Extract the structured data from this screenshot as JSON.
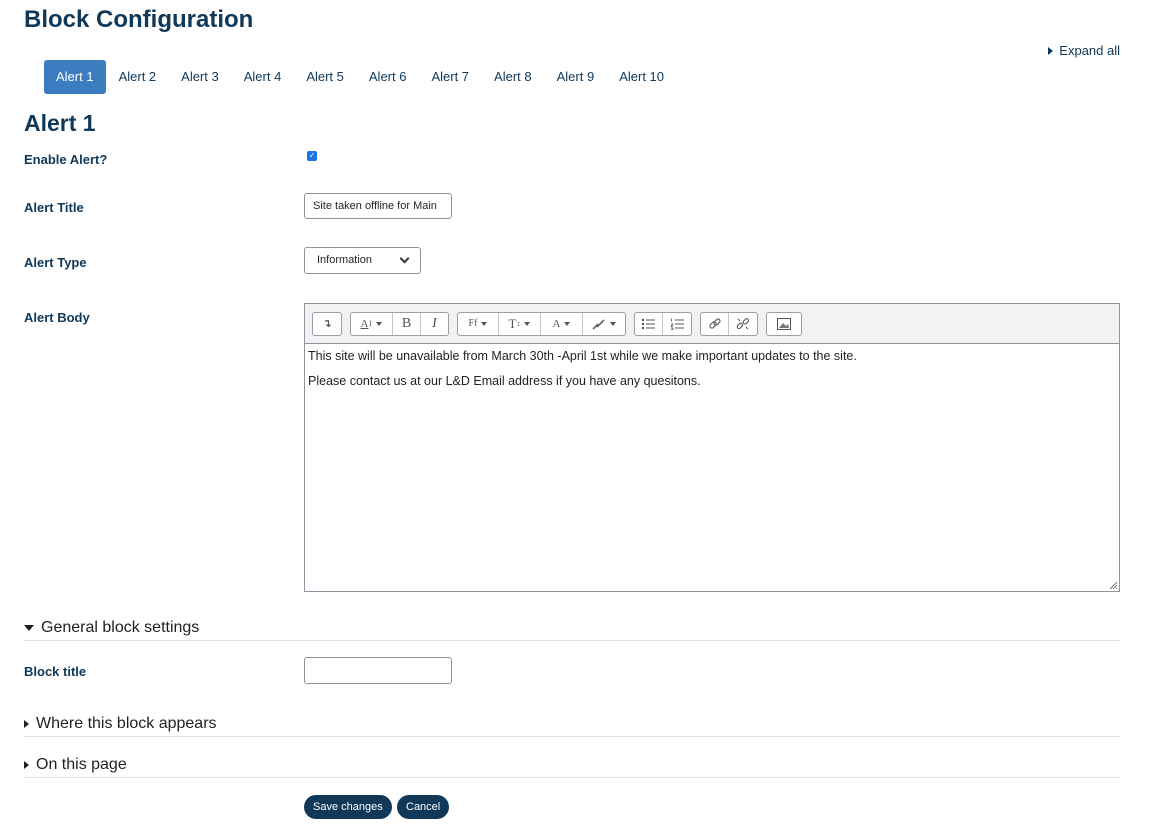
{
  "page_title": "Block Configuration",
  "expand_all": "Expand all",
  "tabs": [
    {
      "label": "Alert 1",
      "active": true
    },
    {
      "label": "Alert 2"
    },
    {
      "label": "Alert 3"
    },
    {
      "label": "Alert 4"
    },
    {
      "label": "Alert 5"
    },
    {
      "label": "Alert 6"
    },
    {
      "label": "Alert 7"
    },
    {
      "label": "Alert 8"
    },
    {
      "label": "Alert 9"
    },
    {
      "label": "Alert 10"
    }
  ],
  "section_title": "Alert 1",
  "form": {
    "enable_label": "Enable Alert?",
    "enable_checked": true,
    "title_label": "Alert Title",
    "title_value": "Site taken offline for Main",
    "type_label": "Alert Type",
    "type_value": "Information",
    "body_label": "Alert Body",
    "body_lines": [
      "This site will be unavailable from March 30th -April 1st while we make important updates to the site.",
      "Please contact us at our L&D Email address if you have any quesitons."
    ]
  },
  "toolbar": {
    "buttons": [
      "↴",
      "A̲",
      "B",
      "I",
      "Ff",
      "Tᵢ",
      "A",
      "brush",
      "list-bullet",
      "list-number",
      "link",
      "unlink",
      "image"
    ]
  },
  "general_settings": {
    "heading": "General block settings",
    "block_title_label": "Block title",
    "block_title_value": ""
  },
  "where_appears": "Where this block appears",
  "on_this_page": "On this page",
  "actions": {
    "save": "Save changes",
    "cancel": "Cancel"
  },
  "colors": {
    "primary": "#0f3859",
    "tab_active": "#3b7dbf",
    "checkbox": "#1a73e8"
  }
}
